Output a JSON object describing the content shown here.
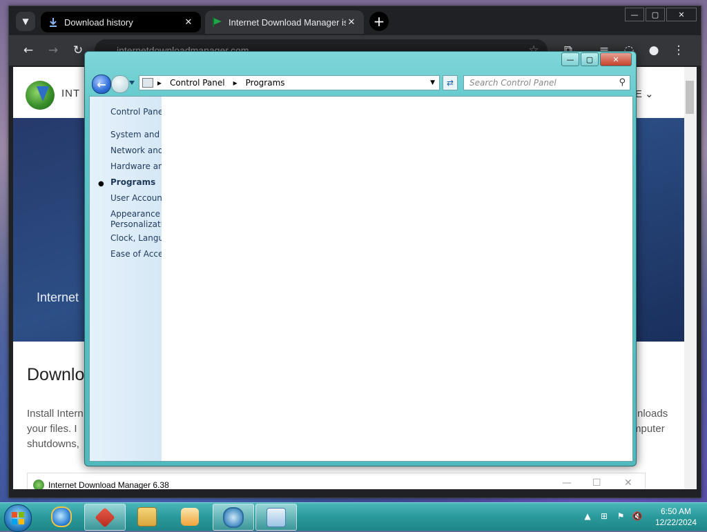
{
  "browser": {
    "tabs": [
      {
        "title": "Download history",
        "icon": "download-icon"
      },
      {
        "title": "Internet Download Manager is...",
        "icon": "flag-icon"
      }
    ],
    "url": "internetdownloadmanager.com"
  },
  "webpage": {
    "site_name": "INT",
    "more_menu": "RE",
    "hero_text": "Internet",
    "download_title": "Downlo",
    "body_lines_left": [
      "Install Intern",
      "your files. I",
      "shutdowns,"
    ],
    "body_lines_right": [
      "nloads",
      "mputer"
    ],
    "idm_window_title": "Internet Download Manager 6.38"
  },
  "control_panel": {
    "breadcrumb": [
      "Control Panel",
      "Programs"
    ],
    "search_placeholder": "Search Control Panel",
    "nav": {
      "home": "Control Panel",
      "items": [
        "System and Se",
        "Network and I",
        "Hardware and",
        "Programs",
        "User Accounts",
        "Appearance ar",
        "Personalization",
        "Clock, Langua",
        "Ease of Access"
      ],
      "selected": "Programs"
    }
  },
  "taskbar": {
    "apps": [
      "ie-icon",
      "media-icon",
      "explorer-icon",
      "video-icon",
      "idm-icon",
      "control-panel-icon"
    ],
    "clock_time": "6:50 AM",
    "clock_date": "12/22/2024"
  },
  "colors": {
    "window_frame": "#5ec7c9",
    "taskbar": "#2a9a9c",
    "chrome_bg": "#202124"
  }
}
